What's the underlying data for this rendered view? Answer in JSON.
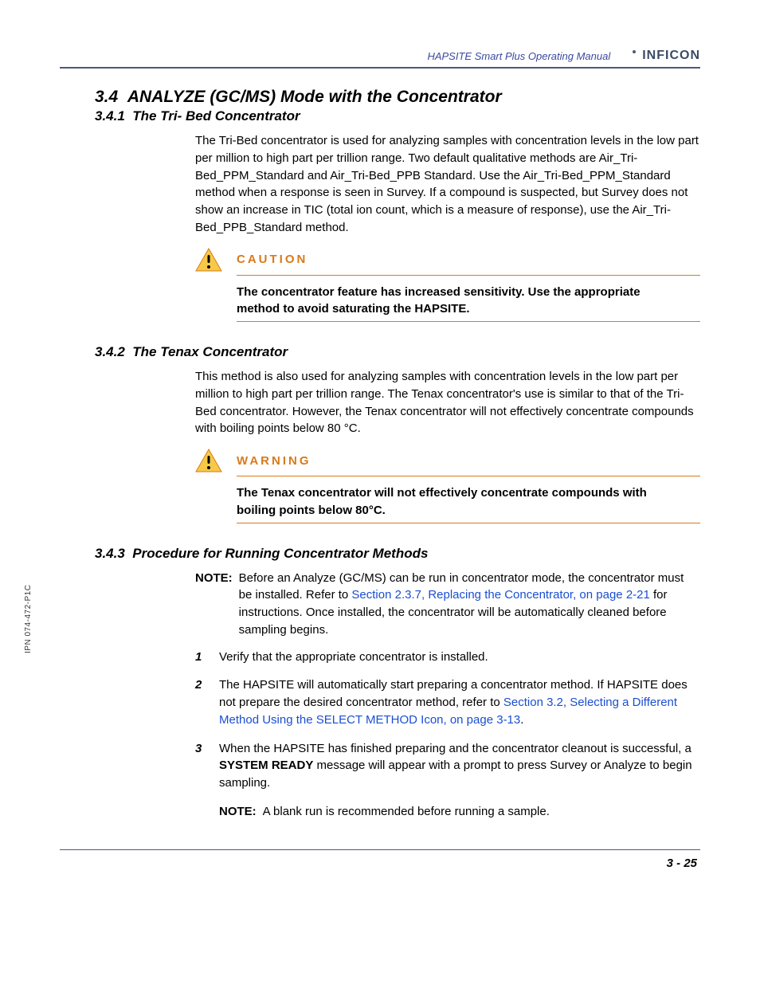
{
  "header": {
    "manual_title": "HAPSITE Smart Plus Operating Manual",
    "logo_text": "INFICON"
  },
  "side_code": "IPN 074-472-P1C",
  "page_number": "3 - 25",
  "sections": {
    "s34": {
      "number": "3.4",
      "title": "ANALYZE (GC/MS) Mode with the Concentrator"
    },
    "s341": {
      "number": "3.4.1",
      "title": "The Tri- Bed Concentrator",
      "body": "The Tri-Bed concentrator is used for analyzing samples with concentration levels in the low part per million to high part per trillion range. Two default qualitative methods are Air_Tri-Bed_PPM_Standard and Air_Tri-Bed_PPB Standard. Use the Air_Tri-Bed_PPM_Standard method when a response is seen in Survey. If a compound is suspected, but Survey does not show an increase in TIC (total ion count, which is a measure of response), use the Air_Tri-Bed_PPB_Standard method."
    },
    "caution": {
      "label": "CAUTION",
      "body": "The concentrator feature has increased sensitivity. Use the appropriate method to avoid saturating the HAPSITE."
    },
    "s342": {
      "number": "3.4.2",
      "title": "The Tenax Concentrator",
      "body": "This method is also used for analyzing samples with concentration levels in the low part per million to high part per trillion range. The Tenax concentrator's use is similar to that of the Tri-Bed concentrator. However, the Tenax concentrator will not effectively concentrate compounds with boiling points below 80 °C."
    },
    "warning": {
      "label": "WARNING",
      "body": "The Tenax concentrator will not effectively concentrate compounds with boiling points below 80°C."
    },
    "s343": {
      "number": "3.4.3",
      "title": "Procedure for Running Concentrator Methods",
      "note_label": "NOTE:",
      "note_pre": "Before an Analyze (GC/MS) can be run in concentrator mode, the concentrator must be installed. Refer to ",
      "note_link": "Section 2.3.7, Replacing the Concentrator, on page 2-21",
      "note_post": " for instructions. Once installed, the concentrator will be automatically cleaned before sampling begins.",
      "steps": [
        {
          "n": "1",
          "text": "Verify that the appropriate concentrator is installed."
        },
        {
          "n": "2",
          "pre": "The HAPSITE will automatically start preparing a concentrator method. If HAPSITE does not prepare the desired concentrator method, refer to ",
          "link": "Section 3.2, Selecting a Different Method Using the SELECT METHOD Icon, on page 3-13",
          "post": "."
        },
        {
          "n": "3",
          "pre": "When the HAPSITE has finished preparing and the concentrator cleanout is successful, a ",
          "bold": "SYSTEM READY",
          "post": " message will appear with a prompt to press Survey or Analyze to begin sampling.",
          "note_label": "NOTE:",
          "note": "A blank run is recommended before running a sample."
        }
      ]
    }
  }
}
